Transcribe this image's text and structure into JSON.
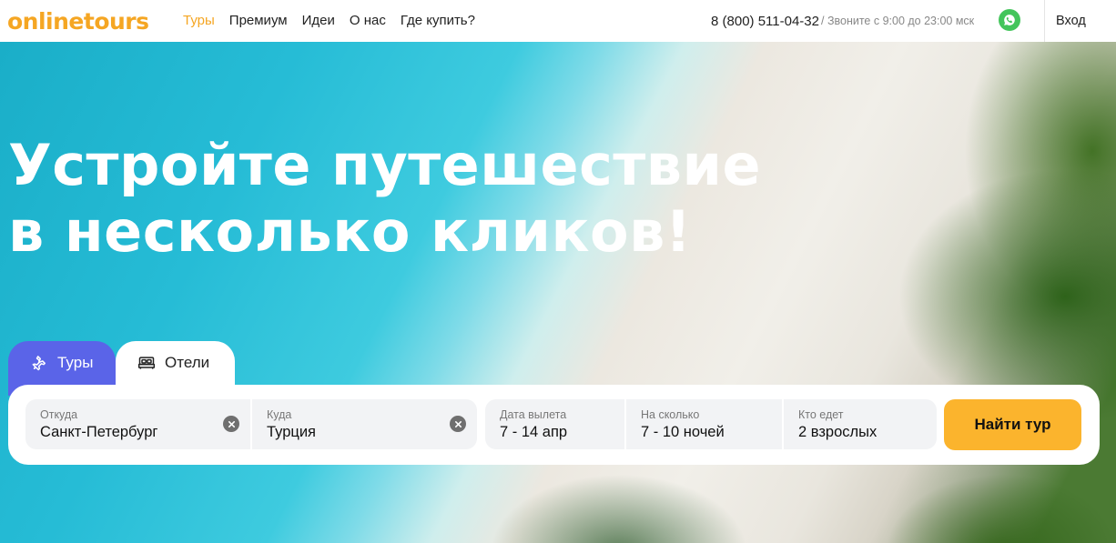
{
  "header": {
    "logo": "onlinetours",
    "nav": [
      {
        "label": "Туры",
        "active": true
      },
      {
        "label": "Премиум"
      },
      {
        "label": "Идеи"
      },
      {
        "label": "О нас"
      },
      {
        "label": "Где купить?"
      }
    ],
    "phone": "8 (800) 511-04-32",
    "phone_note": "/ Звоните с 9:00 до 23:00 мск",
    "whatsapp_icon": "whatsapp-icon",
    "login_label": "Вход"
  },
  "hero": {
    "headline_line1": "Устройте путешествие",
    "headline_line2": "в несколько кликов!"
  },
  "search": {
    "tabs": [
      {
        "label": "Туры",
        "icon": "plane-icon",
        "active": true
      },
      {
        "label": "Отели",
        "icon": "bed-icon",
        "active": false
      }
    ],
    "fields": {
      "from": {
        "label": "Откуда",
        "value": "Санкт-Петербург"
      },
      "to": {
        "label": "Куда",
        "value": "Турция"
      },
      "date": {
        "label": "Дата вылета",
        "value": "7 - 14 апр"
      },
      "nights": {
        "label": "На сколько",
        "value": "7 - 10 ночей"
      },
      "who": {
        "label": "Кто едет",
        "value": "2 взрослых"
      }
    },
    "button_label": "Найти тур"
  },
  "colors": {
    "brand_orange": "#f5a623",
    "tab_active": "#5a64e8",
    "button": "#fbb42d",
    "whatsapp": "#43c55b"
  }
}
